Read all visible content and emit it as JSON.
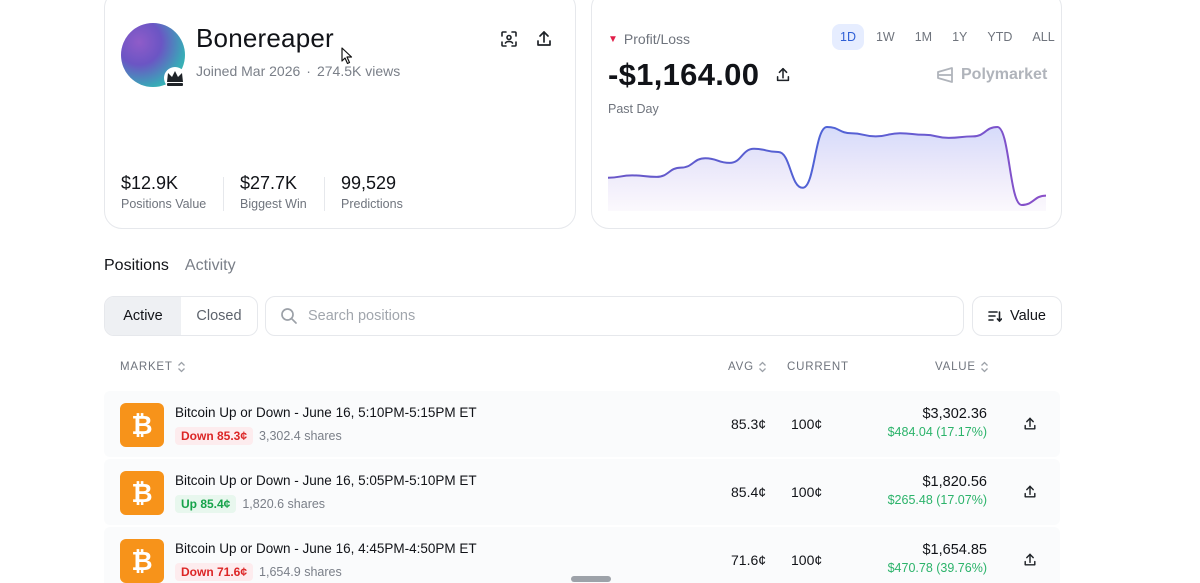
{
  "profile": {
    "username": "Bonereaper",
    "joined": "Joined Mar 2026",
    "separator": "·",
    "views": "274.5K views",
    "icons": {
      "scan": "scan-icon",
      "share": "share-icon",
      "crown": "crown-icon"
    },
    "stats": [
      {
        "value": "$12.9K",
        "label": "Positions Value"
      },
      {
        "value": "$27.7K",
        "label": "Biggest Win"
      },
      {
        "value": "99,529",
        "label": "Predictions"
      }
    ]
  },
  "pnl": {
    "label": "Profit/Loss",
    "value": "-$1,164.00",
    "period_label": "Past Day",
    "brand": "Polymarket",
    "ranges": [
      "1D",
      "1W",
      "1M",
      "1Y",
      "YTD",
      "ALL"
    ],
    "active_range": "1D",
    "colors": {
      "line": "#5b5fd6",
      "loss": "#e11d48",
      "accent": "#2f5fd6"
    },
    "series": [
      0.25,
      0.28,
      0.26,
      0.38,
      0.5,
      0.44,
      0.62,
      0.58,
      0.12,
      0.9,
      0.82,
      0.78,
      0.82,
      0.8,
      0.76,
      0.78,
      0.9,
      -0.1,
      0.02
    ]
  },
  "tabs": {
    "positions": "Positions",
    "activity": "Activity"
  },
  "filters": {
    "active": "Active",
    "closed": "Closed",
    "search_placeholder": "Search positions",
    "sort_label": "Value"
  },
  "table": {
    "headers": {
      "market": "MARKET",
      "avg": "AVG",
      "current": "CURRENT",
      "value": "VALUE"
    },
    "rows": [
      {
        "title": "Bitcoin Up or Down - June 16, 5:10PM-5:15PM ET",
        "side": "Down 85.3¢",
        "side_type": "down",
        "shares": "3,302.4 shares",
        "avg": "85.3¢",
        "current": "100¢",
        "value": "$3,302.36",
        "gain": "$484.04 (17.17%)"
      },
      {
        "title": "Bitcoin Up or Down - June 16, 5:05PM-5:10PM ET",
        "side": "Up 85.4¢",
        "side_type": "up",
        "shares": "1,820.6 shares",
        "avg": "85.4¢",
        "current": "100¢",
        "value": "$1,820.56",
        "gain": "$265.48 (17.07%)"
      },
      {
        "title": "Bitcoin Up or Down - June 16, 4:45PM-4:50PM ET",
        "side": "Down 71.6¢",
        "side_type": "down",
        "shares": "1,654.9 shares",
        "avg": "71.6¢",
        "current": "100¢",
        "value": "$1,654.85",
        "gain": "$470.78 (39.76%)"
      }
    ]
  }
}
